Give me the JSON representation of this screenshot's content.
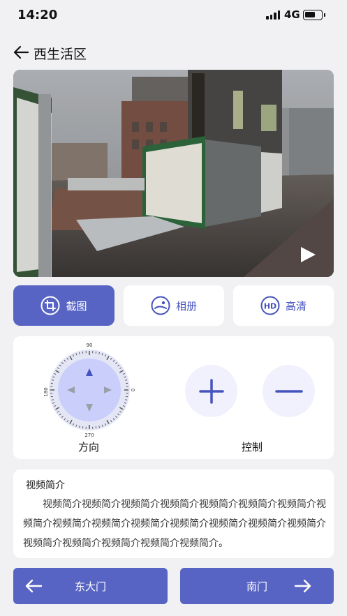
{
  "status_bar": {
    "time": "14:20",
    "network": "4G"
  },
  "nav": {
    "title": "西生活区"
  },
  "video": {
    "scene": "street-view-photo",
    "play_icon": "play-icon"
  },
  "tools": [
    {
      "label": "截图",
      "icon": "crop-icon",
      "active": true
    },
    {
      "label": "相册",
      "icon": "album-icon",
      "active": false
    },
    {
      "label": "高清",
      "icon": "hd-icon",
      "active": false
    }
  ],
  "direction": {
    "label": "方向",
    "dial_labels": {
      "top": "90",
      "left": "180",
      "right": "0",
      "bottom": "270"
    }
  },
  "control": {
    "label": "控制",
    "zoom_in_icon": "plus-icon",
    "zoom_out_icon": "minus-icon"
  },
  "intro": {
    "title": "视频简介",
    "body": "视频简介视频简介视频简介视频简介视频简介视频简介视频简介视频简介视频简介视频简介视频简介视频简介视频简介视频简介视频简介视频简介视频简介视频简介视频简介视频简介。"
  },
  "gates": {
    "prev": "东大门",
    "next": "南门"
  },
  "colors": {
    "accent": "#5864c4",
    "accent_text": "#4553bd",
    "page_bg": "#f1f1f4",
    "card_bg": "#ffffff"
  }
}
